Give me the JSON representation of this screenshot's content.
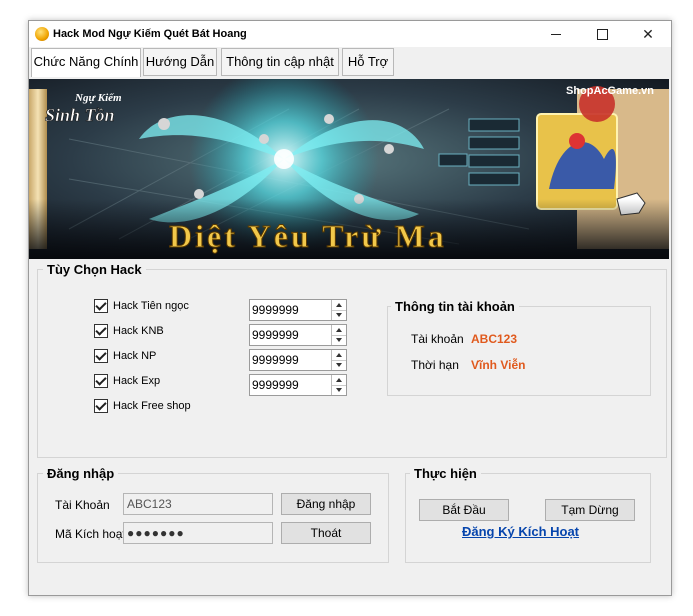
{
  "window": {
    "title": "Hack Mod Ngự Kiếm Quét Bát Hoang"
  },
  "tabs": [
    {
      "label": "Chức Năng Chính",
      "active": true
    },
    {
      "label": "Hướng Dẫn"
    },
    {
      "label": "Thông tin cập nhật"
    },
    {
      "label": "Hỗ Trợ"
    }
  ],
  "banner": {
    "logo_top": "Ngự Kiếm",
    "logo_bottom": "Sinh Tồn",
    "site": "ShopAcGame.vn",
    "slogan": "Diệt Yêu Trừ Ma"
  },
  "hack_options": {
    "title": "Tùy Chọn Hack",
    "items": [
      {
        "label": "Hack Tiên ngọc",
        "checked": true,
        "value": "9999999"
      },
      {
        "label": "Hack KNB",
        "checked": true,
        "value": "9999999"
      },
      {
        "label": "Hack NP",
        "checked": true,
        "value": "9999999"
      },
      {
        "label": "Hack Exp",
        "checked": true,
        "value": "9999999"
      },
      {
        "label": "Hack Free shop",
        "checked": true
      }
    ]
  },
  "account_info": {
    "title": "Thông tin tài khoản",
    "account_label": "Tài khoản",
    "account_value": "ABC123",
    "term_label": "Thời hạn",
    "term_value": "Vĩnh Viễn"
  },
  "login": {
    "title": "Đăng nhập",
    "account_label": "Tài Khoản",
    "account_value": "ABC123",
    "code_label": "Mã Kích hoạt",
    "code_value": "●●●●●●●",
    "login_button": "Đăng nhập",
    "exit_button": "Thoát"
  },
  "execute": {
    "title": "Thực hiện",
    "start_button": "Bắt Đầu",
    "pause_button": "Tạm Dừng",
    "register_link": "Đăng Ký Kích Hoạt"
  },
  "colors": {
    "accent_value": "#e05a1e",
    "link": "#0645ad"
  }
}
